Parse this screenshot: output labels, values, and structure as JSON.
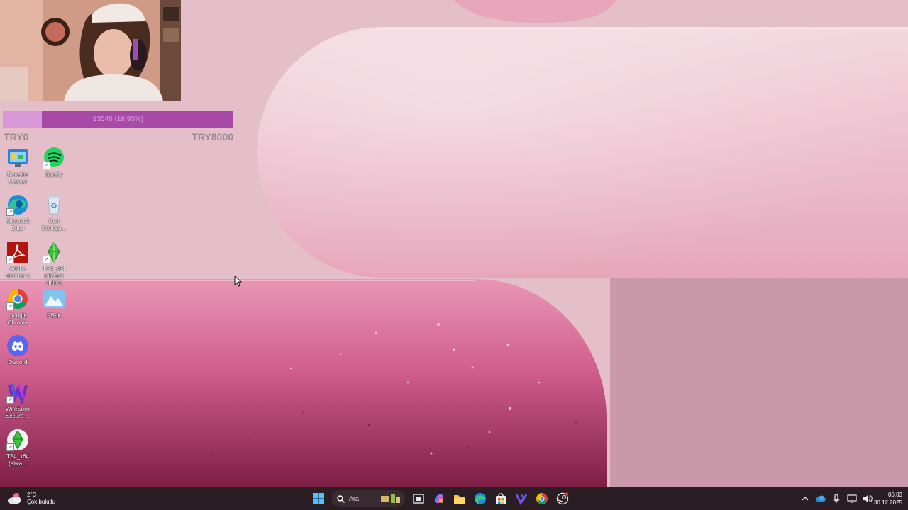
{
  "donation": {
    "progress_text": "13546 (16.93%)",
    "progress_fraction": 0.1693,
    "min_label": "TRY0",
    "max_label": "TRY8000"
  },
  "desktop_icons": [
    {
      "name": "control-panel",
      "label": "Denetim Masası",
      "icon": "control-panel-icon"
    },
    {
      "name": "spotify",
      "label": "Spotify",
      "icon": "spotify-icon"
    },
    {
      "name": "microsoft-edge",
      "label": "Microsoft Edge",
      "icon": "edge-icon"
    },
    {
      "name": "recycle-bin",
      "label": "Geri Dönüşü...",
      "icon": "recycle-bin-icon"
    },
    {
      "name": "adobe-reader",
      "label": "Adobe Reader X",
      "icon": "adobe-reader-icon"
    },
    {
      "name": "ts4-always-offline",
      "label": "TS4_x64 (always offline)",
      "icon": "sims-plumbob-icon"
    },
    {
      "name": "google-chrome",
      "label": "Google Chrome",
      "icon": "chrome-icon"
    },
    {
      "name": "pbak",
      "label": "PBak",
      "icon": "pbak-mountain-icon"
    },
    {
      "name": "discord",
      "label": "Discord",
      "icon": "discord-icon"
    },
    {
      "name": "wiresock",
      "label": "WireSock Secure ...",
      "icon": "wiresock-icon"
    },
    {
      "name": "ts4-x64",
      "label": "TS4_x64 (alwa...",
      "icon": "sims-plumbob-icon"
    }
  ],
  "taskbar": {
    "weather_temp": "2°C",
    "weather_desc": "Çok bulutlu",
    "search_placeholder": "Ara",
    "time": "06:03",
    "date": "30.12.2025",
    "pinned": [
      "start-icon",
      "search-icon",
      "task-view-icon",
      "copilot-icon",
      "file-explorer-icon",
      "edge-icon",
      "store-icon",
      "visual-studio-icon",
      "chrome-icon",
      "steam-icon"
    ],
    "tray": [
      "chevron-up-icon",
      "onedrive-icon",
      "microphone-icon",
      "display-icon",
      "speaker-icon"
    ]
  },
  "colors": {
    "donation_bar": "#a849a8",
    "donation_fill": "#d898d6",
    "taskbar": "#2a1d24"
  }
}
